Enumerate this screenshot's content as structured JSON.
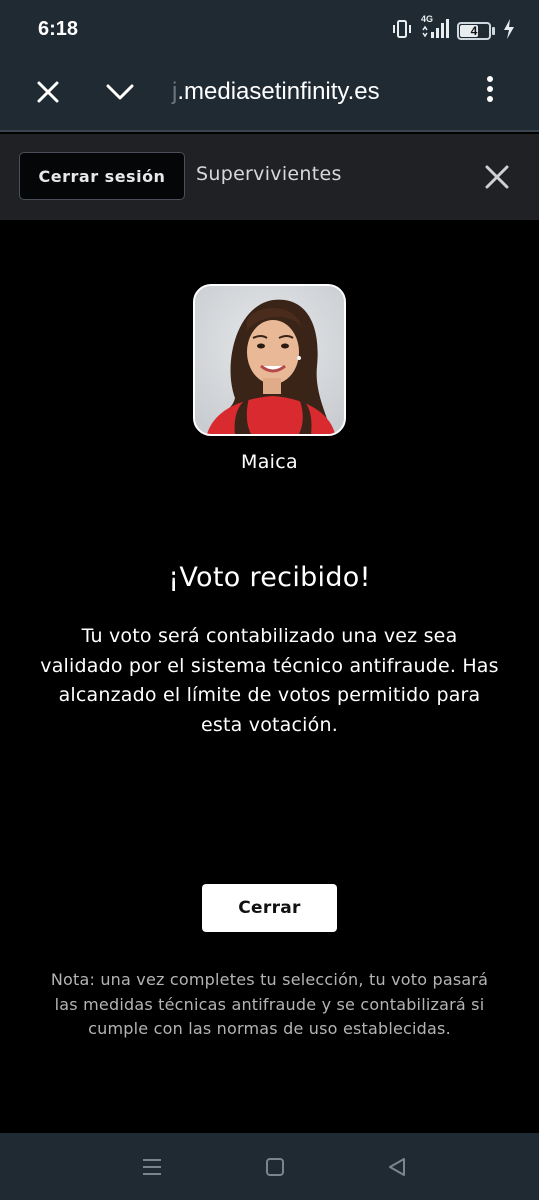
{
  "status_bar": {
    "time": "6:18",
    "network_label": "4G",
    "battery_level": "4",
    "icons": [
      "vibrate-icon",
      "signal-icon",
      "battery-icon",
      "charging-icon"
    ]
  },
  "browser": {
    "url_fade": "j",
    "url": ".mediasetinfinity.es",
    "icons": [
      "close-icon",
      "chevron-down-icon",
      "more-vert-icon"
    ]
  },
  "header": {
    "logout_label": "Cerrar sesión",
    "title": "Supervivientes",
    "icons": [
      "close-icon"
    ]
  },
  "candidate": {
    "name": "Maica"
  },
  "result": {
    "title": "¡Voto recibido!",
    "message": "Tu voto será contabilizado una vez sea validado por el sistema técnico antifraude. Has alcanzado el límite de votos permitido para esta votación."
  },
  "actions": {
    "close_label": "Cerrar"
  },
  "note": "Nota: una vez completes tu selección, tu voto pasará las medidas técnicas antifraude y se contabilizará si cumple con las normas de uso establecidas.",
  "nav": {
    "icons": [
      "menu-icon",
      "home-icon",
      "back-icon"
    ]
  },
  "colors": {
    "system_bar": "#202a33",
    "app_header": "#1f2125",
    "background": "#000000",
    "primary_button": "#ffffff",
    "note_text": "#b4b4b4"
  }
}
